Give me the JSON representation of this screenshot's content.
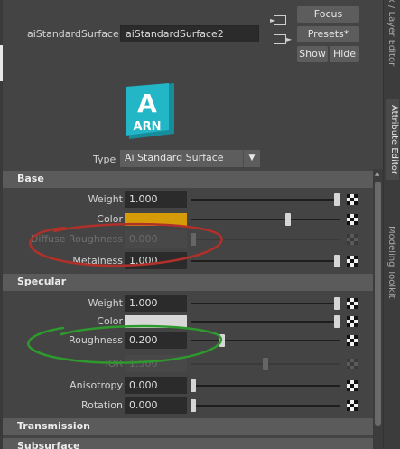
{
  "header": {
    "node_type_label": "aiStandardSurface:",
    "node_name_value": "aiStandardSurface2",
    "buttons": {
      "focus": "Focus",
      "presets": "Presets*",
      "show": "Show",
      "hide": "Hide"
    }
  },
  "side_tabs": [
    {
      "label": "Channel Box / Layer Editor",
      "state": "inactive"
    },
    {
      "label": "Attribute Editor",
      "state": "active"
    },
    {
      "label": "Modeling Toolkit",
      "state": "inactive"
    }
  ],
  "logo": {
    "letter": "A",
    "text": "ARN",
    "color": "#1eb4c4",
    "icon": "arnold-logo-icon"
  },
  "type_row": {
    "label": "Type",
    "selected": "Ai Standard Surface"
  },
  "sections": {
    "base": {
      "title": "Base",
      "rows": [
        {
          "label": "Weight",
          "value": "1.000",
          "slider_fraction": 1.0
        },
        {
          "label": "Color",
          "swatch": "#d59b08",
          "slider_fraction": 0.75
        },
        {
          "label": "Diffuse Roughness",
          "value": "0.000",
          "slider_fraction": 0.0,
          "disabled": true
        },
        {
          "label": "Metalness",
          "value": "1.000",
          "slider_fraction": 1.0
        }
      ]
    },
    "specular": {
      "title": "Specular",
      "rows": [
        {
          "label": "Weight",
          "value": "1.000",
          "slider_fraction": 1.0
        },
        {
          "label": "Color",
          "swatch": "#d8d8d8",
          "slider_fraction": 1.0
        },
        {
          "label": "Roughness",
          "value": "0.200",
          "slider_fraction": 0.2
        },
        {
          "label": "IOR",
          "value": "1.500",
          "slider_fraction": 0.5,
          "disabled": true
        },
        {
          "label": "Anisotropy",
          "value": "0.000",
          "slider_fraction": 0.0
        },
        {
          "label": "Rotation",
          "value": "0.000",
          "slider_fraction": 0.0
        }
      ]
    },
    "transmission": {
      "title": "Transmission"
    },
    "subsurface": {
      "title": "Subsurface"
    }
  },
  "annotations": {
    "metalness_circle_color": "#b0302a",
    "roughness_circle_color": "#2e9a2e"
  }
}
